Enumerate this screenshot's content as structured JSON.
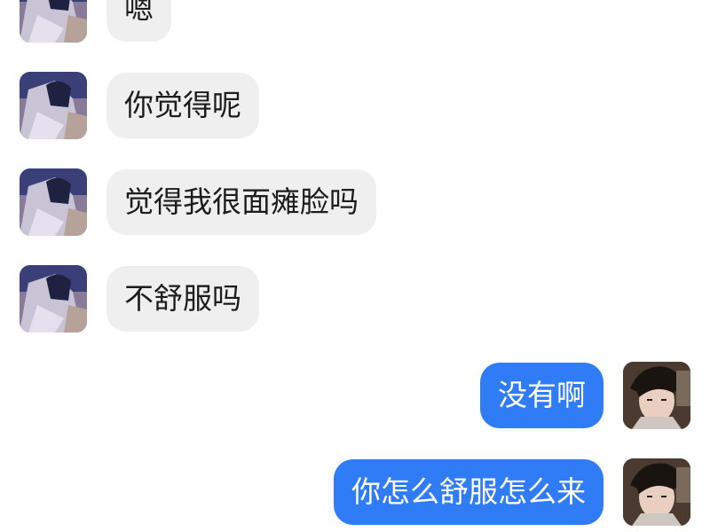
{
  "conversation": {
    "incoming_messages": [
      {
        "text": "嗯"
      },
      {
        "text": "你觉得呢"
      },
      {
        "text": "觉得我很面瘫脸吗"
      },
      {
        "text": "不舒服吗"
      }
    ],
    "outgoing_messages": [
      {
        "text": "没有啊"
      },
      {
        "text": "你怎么舒服怎么来"
      }
    ]
  },
  "colors": {
    "incoming_bubble": "#efefef",
    "outgoing_bubble": "#2f7cf6",
    "background": "#ffffff"
  }
}
